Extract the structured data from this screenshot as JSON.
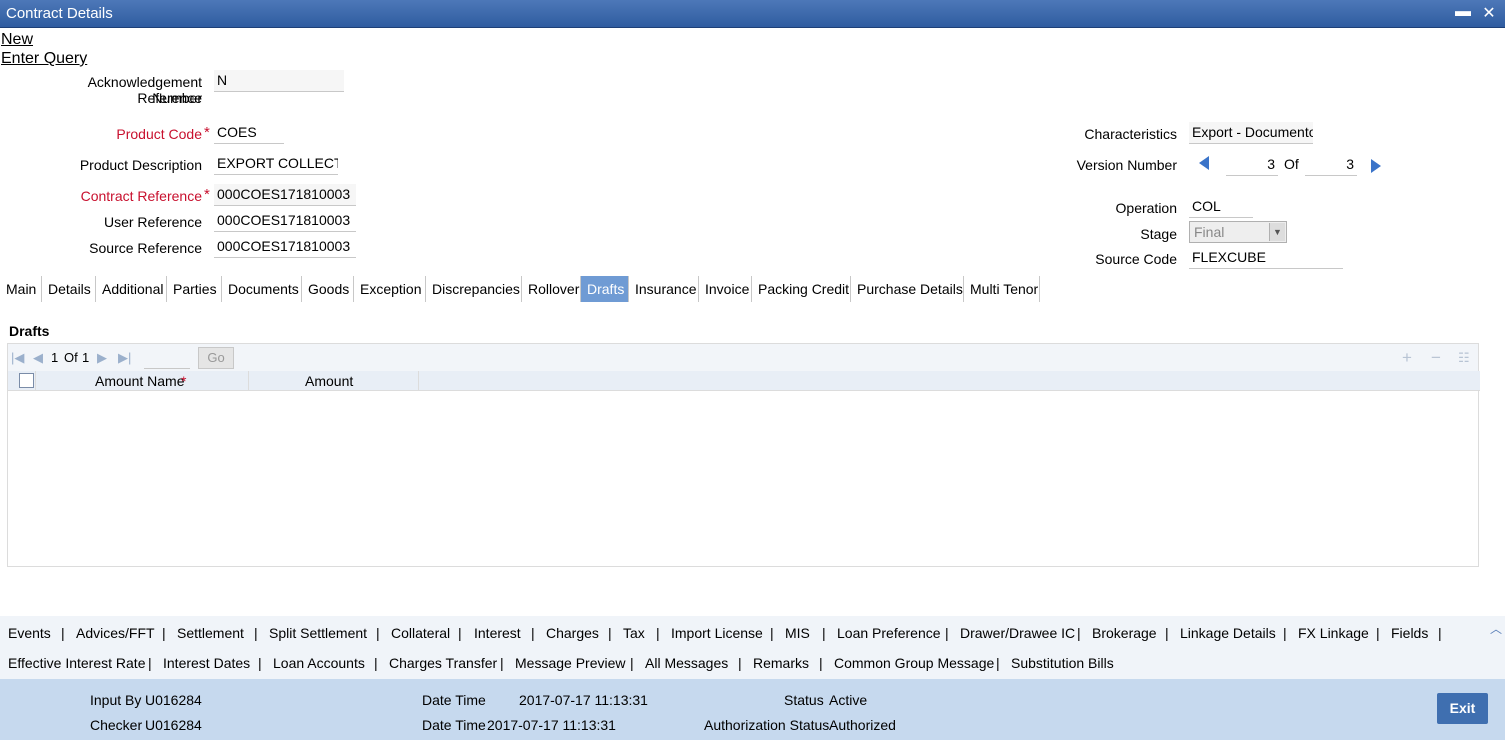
{
  "window": {
    "title": "Contract Details",
    "minimize": "▬",
    "close": "✕"
  },
  "menu": {
    "new": "New",
    "enter_query": "Enter Query"
  },
  "form": {
    "ack_ref_label_1": "Acknowledgement Reference",
    "ack_ref_label_2": "Number",
    "ack_ref_value": "N",
    "product_code_label": "Product Code",
    "product_code_value": "COES",
    "product_desc_label": "Product Description",
    "product_desc_value": "EXPORT COLLECTIO",
    "contract_ref_label": "Contract Reference",
    "contract_ref_value": "000COES171810003",
    "user_ref_label": "User Reference",
    "user_ref_value": "000COES171810003",
    "source_ref_label": "Source Reference",
    "source_ref_value": "000COES171810003",
    "characteristics_label": "Characteristics",
    "characteristics_value": "Export  - Documento",
    "version_label": "Version Number",
    "version_current": "3",
    "version_of": "Of",
    "version_total": "3",
    "operation_label": "Operation",
    "operation_value": "COL",
    "stage_label": "Stage",
    "stage_value": "Final",
    "source_code_label": "Source Code",
    "source_code_value": "FLEXCUBE",
    "required_mark": "*"
  },
  "tabs": [
    "Main",
    "Details",
    "Additional",
    "Parties",
    "Documents",
    "Goods",
    "Exception",
    "Discrepancies",
    "Rollover",
    "Drafts",
    "Insurance",
    "Invoice",
    "Packing Credit",
    "Purchase Details",
    "Multi Tenor"
  ],
  "active_tab": "Drafts",
  "drafts": {
    "section_title": "Drafts",
    "pager_current": "1",
    "pager_of": "Of",
    "pager_total": "1",
    "go_label": "Go",
    "columns": [
      "Amount Name",
      "Amount"
    ],
    "required_mark": "*"
  },
  "links_row1": [
    "Events",
    "Advices/FFT",
    "Settlement",
    "Split Settlement",
    "Collateral",
    "Interest",
    "Charges",
    "Tax",
    "Import License",
    "MIS",
    "Loan Preference",
    "Drawer/Drawee IC",
    "Brokerage",
    "Linkage Details",
    "FX Linkage",
    "Fields"
  ],
  "links_row2": [
    "Effective Interest Rate",
    "Interest Dates",
    "Loan Accounts",
    "Charges Transfer",
    "Message Preview",
    "All Messages",
    "Remarks",
    "Common Group Message",
    "Substitution Bills"
  ],
  "separator": "|",
  "footer": {
    "input_by_label": "Input By",
    "input_by_value": "U016284",
    "checker_label": "Checker",
    "checker_value": "U016284",
    "date_time_label": "Date Time",
    "date_time_1": "2017-07-17 11:13:31",
    "date_time_2": "2017-07-17 11:13:31",
    "status_label": "Status",
    "status_value": "Active",
    "auth_status_label": "Authorization Status",
    "auth_status_value": "Authorized",
    "exit_label": "Exit"
  },
  "colors": {
    "title_bar": "#3b66a8",
    "active_tab": "#6f9bd4",
    "required": "#c8102e",
    "footer": "#c6d9ee",
    "exit_button": "#3f6fb0"
  }
}
